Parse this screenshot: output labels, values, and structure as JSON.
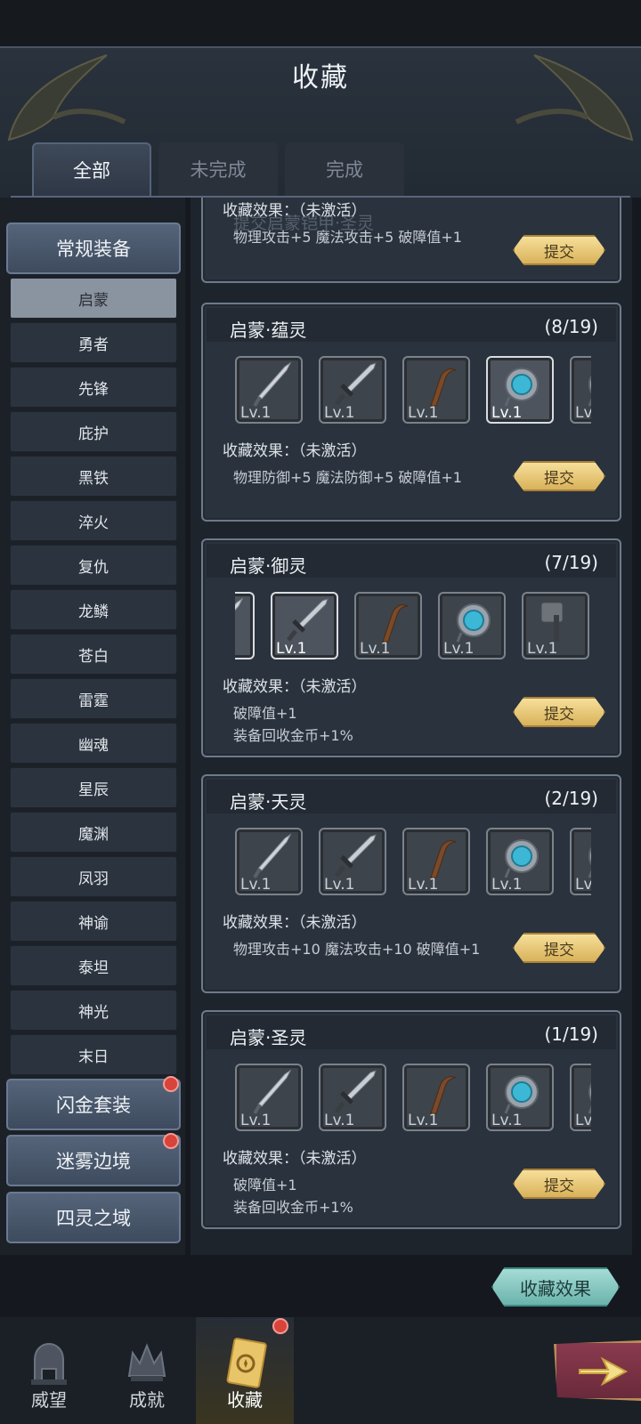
{
  "header": {
    "title": "收藏"
  },
  "tabs": [
    {
      "label": "全部",
      "active": true
    },
    {
      "label": "未完成",
      "active": false
    },
    {
      "label": "完成",
      "active": false
    }
  ],
  "sidebar": {
    "sections": [
      {
        "label": "常规装备",
        "badge": false
      },
      {
        "label": "闪金套装",
        "badge": true
      },
      {
        "label": "迷雾边境",
        "badge": true
      },
      {
        "label": "四灵之域",
        "badge": false
      }
    ],
    "items": [
      "启蒙",
      "勇者",
      "先锋",
      "庇护",
      "黑铁",
      "淬火",
      "复仇",
      "龙鳞",
      "苍白",
      "雷霆",
      "幽魂",
      "星辰",
      "魔渊",
      "凤羽",
      "神谕",
      "泰坦",
      "神光",
      "末日"
    ],
    "active_item": "启蒙"
  },
  "cards": [
    {
      "title": "",
      "count": "",
      "ghost_text": "提交启蒙铠甲·圣灵",
      "effect_label": "收藏效果：（未激活）",
      "effect_lines": [
        "物理攻击+5  魔法攻击+5  破障值+1"
      ],
      "submit": "提交"
    },
    {
      "title": "启蒙·蕴灵",
      "count": "(8/19)",
      "effect_label": "收藏效果：（未激活）",
      "effect_lines": [
        "物理防御+5  魔法防御+5  破障值+1"
      ],
      "submit": "提交",
      "items": [
        {
          "type": "spear",
          "level": "Lv.1",
          "highlight": false
        },
        {
          "type": "sword",
          "level": "Lv.1",
          "highlight": false
        },
        {
          "type": "staff",
          "level": "Lv.1",
          "highlight": false
        },
        {
          "type": "orb",
          "level": "Lv.1",
          "highlight": true
        },
        {
          "type": "orb",
          "level": "Lv",
          "highlight": false
        }
      ]
    },
    {
      "title": "启蒙·御灵",
      "count": "(7/19)",
      "effect_label": "收藏效果：（未激活）",
      "effect_lines": [
        "破障值+1",
        "装备回收金币+1%"
      ],
      "submit": "提交",
      "items": [
        {
          "type": "spear",
          "level": "",
          "highlight": true
        },
        {
          "type": "sword",
          "level": "Lv.1",
          "highlight": true
        },
        {
          "type": "staff",
          "level": "Lv.1",
          "highlight": false
        },
        {
          "type": "orb",
          "level": "Lv.1",
          "highlight": false
        },
        {
          "type": "hammer",
          "level": "Lv.1",
          "highlight": false
        }
      ]
    },
    {
      "title": "启蒙·天灵",
      "count": "(2/19)",
      "effect_label": "收藏效果：（未激活）",
      "effect_lines": [
        "物理攻击+10  魔法攻击+10  破障值+1"
      ],
      "submit": "提交",
      "items": [
        {
          "type": "spear",
          "level": "Lv.1",
          "highlight": false
        },
        {
          "type": "sword",
          "level": "Lv.1",
          "highlight": false
        },
        {
          "type": "staff",
          "level": "Lv.1",
          "highlight": false
        },
        {
          "type": "orb",
          "level": "Lv.1",
          "highlight": false
        },
        {
          "type": "orb",
          "level": "Lv",
          "highlight": false
        }
      ]
    },
    {
      "title": "启蒙·圣灵",
      "count": "(1/19)",
      "effect_label": "收藏效果：（未激活）",
      "effect_lines": [
        "破障值+1",
        "装备回收金币+1%"
      ],
      "submit": "提交",
      "items": [
        {
          "type": "spear",
          "level": "Lv.1",
          "highlight": false
        },
        {
          "type": "sword",
          "level": "Lv.1",
          "highlight": false
        },
        {
          "type": "staff",
          "level": "Lv.1",
          "highlight": false
        },
        {
          "type": "orb",
          "level": "Lv.1",
          "highlight": false
        },
        {
          "type": "orb",
          "level": "Lv",
          "highlight": false
        }
      ]
    }
  ],
  "effect_button": "收藏效果",
  "nav": [
    {
      "label": "威望",
      "icon": "helmet-icon",
      "active": false,
      "badge": false
    },
    {
      "label": "成就",
      "icon": "crown-icon",
      "active": false,
      "badge": false
    },
    {
      "label": "收藏",
      "icon": "card-icon",
      "active": true,
      "badge": true
    }
  ]
}
